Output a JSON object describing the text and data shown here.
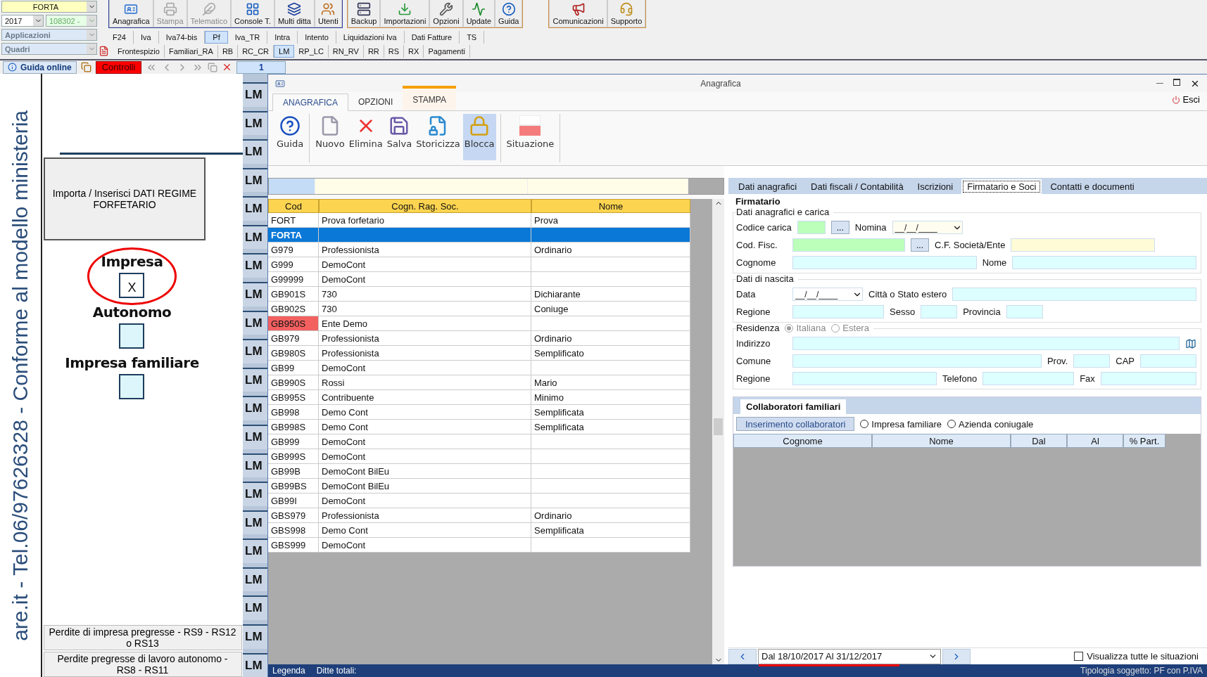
{
  "top": {
    "company": "FORTA",
    "year": "2017",
    "code": "108302 -",
    "apps": "Applicazioni",
    "quadri": "Quadri",
    "toolbar_groups": [
      [
        {
          "label": "Anagrafica",
          "disabled": false
        },
        {
          "label": "Stampa",
          "disabled": true
        },
        {
          "label": "Telematico",
          "disabled": true
        },
        {
          "label": "Console T.",
          "disabled": false
        },
        {
          "label": "Multi ditta",
          "disabled": false
        },
        {
          "label": "Utenti",
          "disabled": false
        }
      ],
      [
        {
          "label": "Backup",
          "disabled": false
        },
        {
          "label": "Importazioni",
          "disabled": false
        },
        {
          "label": "Opzioni",
          "disabled": false
        },
        {
          "label": "Update",
          "disabled": false
        },
        {
          "label": "Guida",
          "disabled": false
        }
      ],
      [
        {
          "label": "Comunicazioni",
          "disabled": false
        },
        {
          "label": "Supporto",
          "disabled": false
        }
      ]
    ],
    "app_tabs": [
      {
        "label": "F24",
        "selected": false
      },
      {
        "label": "Iva",
        "selected": false
      },
      {
        "label": "Iva74-bis",
        "selected": false
      },
      {
        "label": "Pf",
        "selected": true
      },
      {
        "label": "Iva_TR",
        "selected": false
      },
      {
        "label": "Intra",
        "selected": false
      },
      {
        "label": "Intento",
        "selected": false
      },
      {
        "label": "Liquidazioni Iva",
        "selected": false
      },
      {
        "label": "Dati Fatture",
        "selected": false
      },
      {
        "label": "TS",
        "selected": false
      }
    ],
    "quadri_tabs": [
      {
        "label": "Frontespizio",
        "selected": false
      },
      {
        "label": "Familiari_RA",
        "selected": false
      },
      {
        "label": "RB",
        "selected": false
      },
      {
        "label": "RC_CR",
        "selected": false
      },
      {
        "label": "LM",
        "selected": true
      },
      {
        "label": "RP_LC",
        "selected": false
      },
      {
        "label": "RN_RV",
        "selected": false
      },
      {
        "label": "RR",
        "selected": false
      },
      {
        "label": "RS",
        "selected": false
      },
      {
        "label": "RX",
        "selected": false
      },
      {
        "label": "Pagamenti",
        "selected": false
      }
    ]
  },
  "nav": {
    "help": "Guida online",
    "controls": "Controlli",
    "page": "1"
  },
  "side_text": "are.it - Tel.06/97626328 - Conforme al modello ministeria",
  "sheet": {
    "import_button": "Importa / Inserisci DATI REGIME FORFETARIO",
    "options": [
      {
        "label": "Impresa",
        "value": "X",
        "checked": true,
        "circled": true
      },
      {
        "label": "Autonomo",
        "checked": false,
        "circled": false
      },
      {
        "label": "Impresa familiare",
        "checked": false,
        "circled": false
      }
    ],
    "loss_buttons": [
      "Perdite di impresa pregresse - RS9 - RS12 o RS13",
      "Perdite pregresse di lavoro autonomo - RS8 - RS11"
    ]
  },
  "lm_tabs": [
    "LM",
    "LM",
    "LM",
    "LM",
    "LM",
    "LM",
    "LM",
    "LM",
    "LM",
    "LM",
    "LM",
    "LM",
    "LM",
    "LM",
    "LM",
    "LM",
    "LM",
    "LM",
    "LM",
    "LM",
    "LM"
  ],
  "dialog": {
    "title": "Anagrafica",
    "exit": "Esci",
    "ribbon_tabs": [
      {
        "label": "ANAGRAFICA",
        "selected": true,
        "contextual": false
      },
      {
        "label": "OPZIONI",
        "selected": false,
        "contextual": false
      },
      {
        "label": "STAMPA",
        "selected": false,
        "contextual": true
      }
    ],
    "ribbon_groups": [
      [
        {
          "label": "Guida",
          "pressed": false
        }
      ],
      [
        {
          "label": "Nuovo",
          "pressed": false
        },
        {
          "label": "Elimina",
          "pressed": false
        },
        {
          "label": "Salva",
          "pressed": false
        },
        {
          "label": "Storicizza",
          "pressed": false
        },
        {
          "label": "Blocca",
          "pressed": true
        }
      ],
      [
        {
          "label": "Situazione",
          "pressed": false
        }
      ]
    ],
    "table": {
      "columns": [
        "Cod",
        "Cogn. Rag. Soc.",
        "Nome"
      ],
      "rows": [
        {
          "cells": [
            "FORT",
            "Prova forfetario",
            "Prova"
          ],
          "selected": false,
          "flagged": false
        },
        {
          "cells": [
            "FORTA"
          ],
          "selected": true,
          "flagged": false
        },
        {
          "cells": [
            "G979",
            "Professionista",
            "Ordinario"
          ],
          "selected": false,
          "flagged": false
        },
        {
          "cells": [
            "G999",
            "DemoCont"
          ],
          "selected": false,
          "flagged": false
        },
        {
          "cells": [
            "G99999",
            "DemoCont"
          ],
          "selected": false,
          "flagged": false
        },
        {
          "cells": [
            "GB901S",
            "730",
            "Dichiarante"
          ],
          "selected": false,
          "flagged": false
        },
        {
          "cells": [
            "GB902S",
            "730",
            "Coniuge"
          ],
          "selected": false,
          "flagged": false
        },
        {
          "cells": [
            "GB950S",
            "Ente Demo"
          ],
          "selected": false,
          "flagged": true
        },
        {
          "cells": [
            "GB979",
            "Professionista",
            "Ordinario"
          ],
          "selected": false,
          "flagged": false
        },
        {
          "cells": [
            "GB980S",
            "Professionista",
            "Semplificato"
          ],
          "selected": false,
          "flagged": false
        },
        {
          "cells": [
            "GB99",
            "DemoCont"
          ],
          "selected": false,
          "flagged": false
        },
        {
          "cells": [
            "GB990S",
            "Rossi",
            "Mario"
          ],
          "selected": false,
          "flagged": false
        },
        {
          "cells": [
            "GB995S",
            "Contribuente",
            "Minimo"
          ],
          "selected": false,
          "flagged": false
        },
        {
          "cells": [
            "GB998",
            "Demo Cont",
            "Semplificata"
          ],
          "selected": false,
          "flagged": false
        },
        {
          "cells": [
            "GB998S",
            "Demo Cont",
            "Semplificata"
          ],
          "selected": false,
          "flagged": false
        },
        {
          "cells": [
            "GB999",
            "DemoCont"
          ],
          "selected": false,
          "flagged": false
        },
        {
          "cells": [
            "GB999S",
            "DemoCont"
          ],
          "selected": false,
          "flagged": false
        },
        {
          "cells": [
            "GB99B",
            "DemoCont BilEu"
          ],
          "selected": false,
          "flagged": false
        },
        {
          "cells": [
            "GB99BS",
            "DemoCont BilEu"
          ],
          "selected": false,
          "flagged": false
        },
        {
          "cells": [
            "GB99I",
            "DemoCont"
          ],
          "selected": false,
          "flagged": false
        },
        {
          "cells": [
            "GBS979",
            "Professionista",
            "Ordinario"
          ],
          "selected": false,
          "flagged": false
        },
        {
          "cells": [
            "GBS998",
            "Demo Cont",
            "Semplificata"
          ],
          "selected": false,
          "flagged": false
        },
        {
          "cells": [
            "GBS999",
            "DemoCont"
          ],
          "selected": false,
          "flagged": false
        }
      ]
    },
    "form": {
      "tabs": [
        {
          "label": "Dati anagrafici",
          "selected": false
        },
        {
          "label": "Dati fiscali / Contabilità",
          "selected": false
        },
        {
          "label": "Iscrizioni",
          "selected": false
        },
        {
          "label": "Firmatario e Soci",
          "selected": true
        },
        {
          "label": "Contatti e documenti",
          "selected": false
        }
      ],
      "title": "Firmatario",
      "sections": [
        {
          "legend": "Dati anagrafici e carica",
          "rows": [
            [
              {
                "label": "Codice carica",
                "kind": "lookup-short",
                "color": "#bbffbb",
                "button": "..."
              },
              {
                "label": "Nomina",
                "kind": "date",
                "color": "#fffdf0",
                "value": "__/__/____"
              }
            ],
            [
              {
                "label": "Cod. Fisc.",
                "kind": "lookup",
                "color": "#bbffbb",
                "button": "..."
              },
              {
                "label": "C.F. Società/Ente",
                "kind": "large",
                "color": "#fffbd6"
              }
            ],
            [
              {
                "label": "Cognome",
                "kind": "text",
                "color": "#ddffff"
              },
              {
                "label": "Nome",
                "kind": "text",
                "color": "#ddffff"
              }
            ]
          ]
        },
        {
          "legend": "Dati di nascita",
          "rows": [
            [
              {
                "label": "Data",
                "kind": "date",
                "color": "#ffffff",
                "value": "__/__/____"
              },
              {
                "label": "Città o Stato estero",
                "kind": "text",
                "color": "#ddffff"
              }
            ],
            [
              {
                "label": "Regione",
                "kind": "medium",
                "color": "#ddffff"
              },
              {
                "label": "Sesso",
                "kind": "small",
                "color": "#ddffff"
              },
              {
                "label": "Provincia",
                "kind": "small",
                "color": "#ddffff"
              }
            ]
          ]
        },
        {
          "legend": "Residenza",
          "radios": [
            {
              "label": "Italiana",
              "selected": true
            },
            {
              "label": "Estera",
              "selected": false
            }
          ],
          "rows": [
            [
              {
                "label": "Indirizzo",
                "kind": "text",
                "color": "#ddffff",
                "map": true
              }
            ],
            [
              {
                "label": "Comune",
                "kind": "text",
                "color": "#ddffff"
              },
              {
                "label": "Prov.",
                "kind": "small",
                "color": "#ddffff"
              },
              {
                "label": "CAP",
                "kind": "cap",
                "color": "#ddffff"
              }
            ],
            [
              {
                "label": "Regione",
                "kind": "large",
                "color": "#ddffff"
              },
              {
                "label": "Telefono",
                "kind": "medium",
                "color": "#ddffff"
              },
              {
                "label": "Fax",
                "kind": "text",
                "color": "#ddffff"
              }
            ]
          ]
        }
      ],
      "collab": {
        "title": "Collaboratori familiari",
        "button": "Inserimento collaboratori",
        "radios": [
          {
            "label": "Impresa familiare",
            "selected": false
          },
          {
            "label": "Azienda coniugale",
            "selected": false
          }
        ],
        "columns": [
          "Cognome",
          "Nome",
          "Dal",
          "Al",
          "% Part."
        ]
      }
    },
    "period": "Dal 18/10/2017 Al 31/12/2017",
    "show_all": {
      "label": "Visualizza tutte le situazioni",
      "checked": false
    },
    "status": {
      "legend": "Legenda",
      "total": "Ditte totali:",
      "type": "Tipologia soggetto: PF con P.IVA"
    }
  }
}
